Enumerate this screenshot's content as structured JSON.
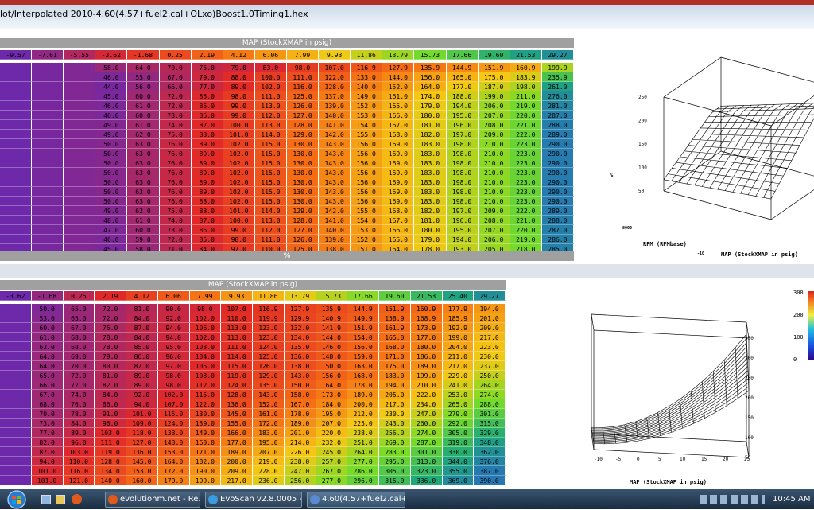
{
  "window": {
    "title": "lot/Interpolated 2010-4.60(4.57+fuel2.cal+OLxo)Boost1.0Timing1.hex"
  },
  "top": {
    "header_label": "MAP (StockXMAP in psig)",
    "footer_label": "%",
    "columns": [
      "-9.57",
      "-7.61",
      "-5.55",
      "-3.62",
      "-1.68",
      "0.25",
      "2.19",
      "4.12",
      "6.06",
      "7.99",
      "9.93",
      "11.86",
      "13.79",
      "15.73",
      "17.66",
      "19.60",
      "21.53",
      "29.27"
    ],
    "rows": [
      [
        "58.0",
        "64.0",
        "70.0",
        "75.0",
        "79.0",
        "83.0",
        "98.0",
        "107.0",
        "116.9",
        "127.9",
        "135.9",
        "144.9",
        "151.9",
        "160.9",
        "199.9"
      ],
      [
        "46.0",
        "55.0",
        "67.0",
        "79.0",
        "88.0",
        "100.0",
        "111.0",
        "122.0",
        "133.0",
        "144.0",
        "156.0",
        "165.0",
        "175.0",
        "183.9",
        "235.9"
      ],
      [
        "44.0",
        "56.0",
        "66.0",
        "77.0",
        "89.0",
        "102.0",
        "116.0",
        "128.0",
        "140.0",
        "152.0",
        "164.0",
        "177.0",
        "187.0",
        "198.0",
        "261.0"
      ],
      [
        "45.0",
        "60.0",
        "72.0",
        "85.0",
        "98.0",
        "111.0",
        "125.0",
        "137.0",
        "149.0",
        "161.0",
        "174.0",
        "188.0",
        "199.0",
        "211.0",
        "276.0"
      ],
      [
        "46.0",
        "61.0",
        "72.0",
        "86.0",
        "99.0",
        "113.0",
        "126.0",
        "139.0",
        "152.0",
        "165.0",
        "179.0",
        "194.0",
        "206.0",
        "219.0",
        "281.0"
      ],
      [
        "46.0",
        "60.0",
        "73.0",
        "86.0",
        "99.0",
        "112.0",
        "127.0",
        "140.0",
        "153.0",
        "166.0",
        "180.0",
        "195.0",
        "207.0",
        "220.0",
        "287.0"
      ],
      [
        "49.0",
        "61.0",
        "74.0",
        "87.0",
        "100.0",
        "113.0",
        "128.0",
        "141.0",
        "154.0",
        "167.0",
        "181.0",
        "196.0",
        "208.0",
        "221.0",
        "288.0"
      ],
      [
        "49.0",
        "62.0",
        "75.0",
        "88.0",
        "101.0",
        "114.0",
        "129.0",
        "142.0",
        "155.0",
        "168.0",
        "182.0",
        "197.0",
        "209.0",
        "222.0",
        "289.0"
      ],
      [
        "50.0",
        "63.0",
        "76.0",
        "89.0",
        "102.0",
        "115.0",
        "130.0",
        "143.0",
        "156.0",
        "169.0",
        "183.0",
        "198.0",
        "210.0",
        "223.0",
        "290.0"
      ],
      [
        "50.0",
        "63.0",
        "76.0",
        "89.0",
        "102.0",
        "115.0",
        "130.0",
        "143.0",
        "156.0",
        "169.0",
        "183.0",
        "198.0",
        "210.0",
        "223.0",
        "290.0"
      ],
      [
        "50.0",
        "63.0",
        "76.0",
        "89.0",
        "102.0",
        "115.0",
        "130.0",
        "143.0",
        "156.0",
        "169.0",
        "183.0",
        "198.0",
        "210.0",
        "223.0",
        "290.0"
      ],
      [
        "50.0",
        "63.0",
        "76.0",
        "89.0",
        "102.0",
        "115.0",
        "130.0",
        "143.0",
        "156.0",
        "169.0",
        "183.0",
        "198.0",
        "210.0",
        "223.0",
        "290.0"
      ],
      [
        "50.0",
        "63.0",
        "76.0",
        "89.0",
        "102.0",
        "115.0",
        "130.0",
        "143.0",
        "156.0",
        "169.0",
        "183.0",
        "198.0",
        "210.0",
        "223.0",
        "290.0"
      ],
      [
        "50.0",
        "63.0",
        "76.0",
        "89.0",
        "102.0",
        "115.0",
        "130.0",
        "143.0",
        "156.0",
        "169.0",
        "183.0",
        "198.0",
        "210.0",
        "223.0",
        "290.0"
      ],
      [
        "50.0",
        "63.0",
        "76.0",
        "88.0",
        "102.0",
        "115.0",
        "130.0",
        "143.0",
        "156.0",
        "169.0",
        "183.0",
        "198.0",
        "210.0",
        "223.0",
        "290.0"
      ],
      [
        "49.0",
        "62.0",
        "75.0",
        "88.0",
        "101.0",
        "114.0",
        "129.0",
        "142.0",
        "155.0",
        "168.0",
        "182.0",
        "197.0",
        "209.0",
        "222.0",
        "289.0"
      ],
      [
        "48.0",
        "61.0",
        "74.0",
        "87.0",
        "100.0",
        "113.0",
        "128.0",
        "141.0",
        "154.0",
        "167.0",
        "181.0",
        "196.0",
        "208.0",
        "221.0",
        "288.0"
      ],
      [
        "47.0",
        "60.0",
        "73.0",
        "86.0",
        "99.0",
        "112.0",
        "127.0",
        "140.0",
        "153.0",
        "166.0",
        "180.0",
        "195.0",
        "207.0",
        "220.0",
        "287.0"
      ],
      [
        "46.0",
        "59.0",
        "72.0",
        "85.0",
        "98.0",
        "111.0",
        "126.0",
        "139.0",
        "152.0",
        "165.0",
        "179.0",
        "194.0",
        "206.0",
        "219.0",
        "286.0"
      ],
      [
        "45.0",
        "58.0",
        "71.0",
        "84.0",
        "97.0",
        "110.0",
        "125.0",
        "138.0",
        "151.0",
        "164.0",
        "178.0",
        "193.0",
        "205.0",
        "218.0",
        "285.0"
      ]
    ]
  },
  "bottom": {
    "header_label": "MAP (StockXMAP in psig)",
    "columns": [
      "-3.62",
      "-1.68",
      "0.25",
      "2.19",
      "4.12",
      "6.06",
      "7.99",
      "9.93",
      "11.86",
      "13.79",
      "15.73",
      "17.66",
      "19.60",
      "21.53",
      "25.40",
      "29.27"
    ],
    "rows": [
      [
        "50.0",
        "65.0",
        "72.0",
        "81.0",
        "90.0",
        "98.0",
        "107.0",
        "116.9",
        "127.9",
        "135.9",
        "144.9",
        "151.9",
        "160.9",
        "177.9",
        "194.0"
      ],
      [
        "53.0",
        "65.0",
        "72.0",
        "84.0",
        "92.0",
        "102.0",
        "110.0",
        "119.9",
        "129.9",
        "140.9",
        "149.9",
        "158.9",
        "168.9",
        "185.9",
        "201.0"
      ],
      [
        "60.0",
        "67.0",
        "76.0",
        "87.0",
        "94.0",
        "106.0",
        "113.0",
        "123.0",
        "132.0",
        "141.9",
        "151.9",
        "161.9",
        "173.9",
        "192.9",
        "209.0"
      ],
      [
        "61.0",
        "68.0",
        "78.0",
        "84.0",
        "94.0",
        "102.0",
        "113.0",
        "123.0",
        "134.0",
        "144.0",
        "154.0",
        "165.0",
        "177.0",
        "199.0",
        "217.0"
      ],
      [
        "62.0",
        "68.0",
        "78.0",
        "85.0",
        "95.0",
        "103.0",
        "111.0",
        "124.0",
        "135.0",
        "146.0",
        "156.0",
        "168.0",
        "180.0",
        "204.0",
        "223.0"
      ],
      [
        "64.0",
        "69.0",
        "79.0",
        "86.0",
        "96.0",
        "104.0",
        "114.0",
        "125.0",
        "136.0",
        "148.0",
        "159.0",
        "171.0",
        "186.0",
        "211.0",
        "230.0"
      ],
      [
        "64.0",
        "70.0",
        "80.0",
        "87.0",
        "97.0",
        "105.0",
        "115.0",
        "126.0",
        "138.0",
        "150.0",
        "163.0",
        "175.0",
        "189.0",
        "217.0",
        "237.0"
      ],
      [
        "65.0",
        "72.0",
        "81.0",
        "89.0",
        "98.0",
        "108.0",
        "119.0",
        "129.0",
        "143.0",
        "156.0",
        "168.0",
        "183.0",
        "199.0",
        "229.0",
        "250.0"
      ],
      [
        "66.0",
        "72.0",
        "82.0",
        "89.0",
        "98.0",
        "112.0",
        "124.0",
        "135.0",
        "150.0",
        "164.0",
        "178.0",
        "194.0",
        "210.0",
        "241.0",
        "264.0"
      ],
      [
        "67.0",
        "74.0",
        "84.0",
        "92.0",
        "102.0",
        "115.0",
        "128.0",
        "143.0",
        "158.0",
        "173.0",
        "189.0",
        "205.0",
        "222.0",
        "253.0",
        "274.0"
      ],
      [
        "68.0",
        "76.0",
        "86.0",
        "94.0",
        "107.0",
        "122.0",
        "136.0",
        "152.0",
        "167.0",
        "184.0",
        "200.0",
        "217.0",
        "234.0",
        "265.0",
        "288.0"
      ],
      [
        "70.0",
        "78.0",
        "91.0",
        "101.0",
        "115.0",
        "130.0",
        "145.0",
        "161.0",
        "178.0",
        "195.0",
        "212.0",
        "230.0",
        "247.0",
        "279.0",
        "301.0"
      ],
      [
        "73.0",
        "84.0",
        "96.0",
        "109.0",
        "124.0",
        "139.0",
        "155.0",
        "172.0",
        "189.0",
        "207.0",
        "225.0",
        "243.0",
        "260.0",
        "292.0",
        "315.0"
      ],
      [
        "77.0",
        "89.0",
        "103.0",
        "118.0",
        "133.0",
        "149.0",
        "166.0",
        "183.0",
        "201.0",
        "220.0",
        "238.0",
        "256.0",
        "274.0",
        "305.0",
        "329.0"
      ],
      [
        "82.0",
        "96.0",
        "111.0",
        "127.0",
        "143.0",
        "160.0",
        "177.0",
        "195.0",
        "214.0",
        "232.0",
        "251.0",
        "269.0",
        "287.0",
        "319.0",
        "348.0"
      ],
      [
        "87.0",
        "103.0",
        "119.0",
        "136.0",
        "153.0",
        "171.0",
        "189.0",
        "207.0",
        "226.0",
        "245.0",
        "264.0",
        "283.0",
        "301.0",
        "330.0",
        "362.0"
      ],
      [
        "94.0",
        "110.0",
        "128.0",
        "145.0",
        "164.0",
        "182.0",
        "200.0",
        "219.0",
        "238.0",
        "257.0",
        "277.0",
        "295.0",
        "313.0",
        "344.0",
        "376.0"
      ],
      [
        "101.0",
        "116.0",
        "134.0",
        "153.0",
        "172.0",
        "190.0",
        "209.0",
        "228.0",
        "247.0",
        "267.0",
        "286.0",
        "305.0",
        "323.0",
        "355.0",
        "387.0"
      ],
      [
        "101.0",
        "121.0",
        "140.0",
        "160.0",
        "179.0",
        "199.0",
        "217.0",
        "236.0",
        "256.0",
        "277.0",
        "296.0",
        "315.0",
        "336.0",
        "369.0",
        "390.0"
      ]
    ]
  },
  "plot_top": {
    "z_ticks": [
      "250",
      "200",
      "150",
      "100",
      "50"
    ],
    "x_label": "RPM (RPMbase)",
    "y_label": "MAP (StockXMAP in psig)",
    "x_ticks": [
      "8000",
      "6000",
      "4000",
      "3000",
      "2000",
      "1000"
    ],
    "y_ticks": [
      "-10",
      "0",
      "5",
      "10",
      "15",
      "20",
      "25"
    ],
    "z_label": "%"
  },
  "plot_bottom": {
    "z_ticks": [
      "350",
      "300",
      "250",
      "200",
      "150",
      "100",
      "50"
    ],
    "x_label": "MAP (StockXMAP in psig)",
    "x_ticks": [
      "-10",
      "-5",
      "0",
      "5",
      "10",
      "15",
      "20",
      "25"
    ],
    "colorbar_ticks": [
      "300",
      "200",
      "100",
      "0"
    ]
  },
  "taskbar": {
    "items": [
      {
        "label": "evolutionm.net - Re...",
        "color": "#e05a1e"
      },
      {
        "label": "EvoScan v2.8.0005 - ...",
        "color": "#3a9be0"
      },
      {
        "label": "4.60(4.57+fuel2.cal+...",
        "color": "#5a8ad0"
      }
    ],
    "time": "10:45 AM"
  }
}
